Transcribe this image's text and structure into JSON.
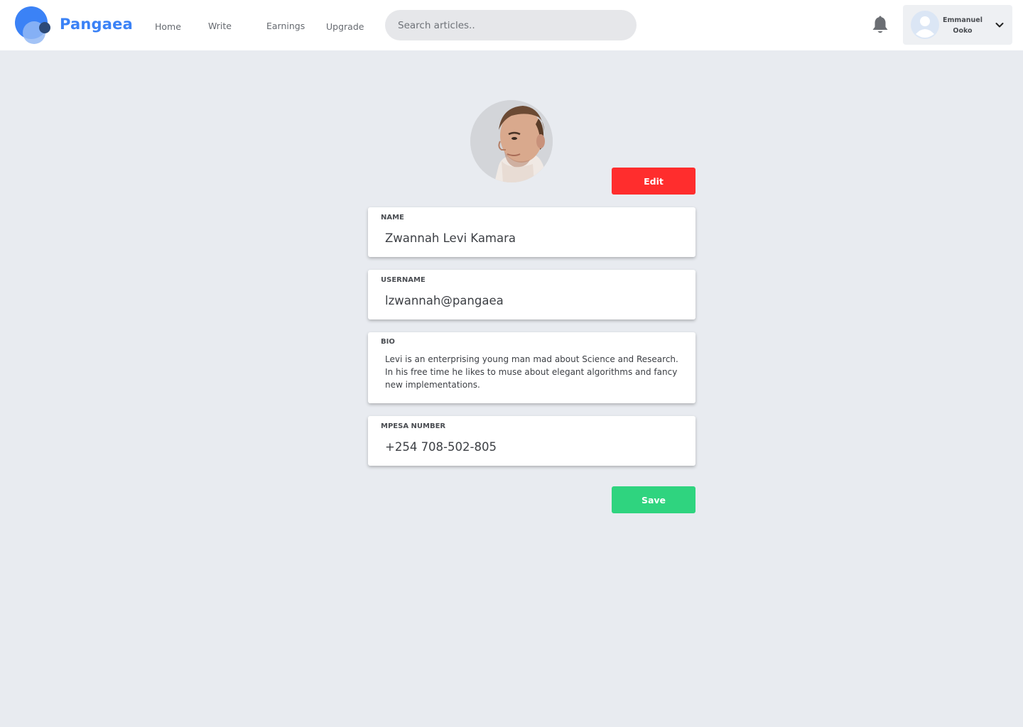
{
  "header": {
    "brand": "Pangaea",
    "nav": [
      "Home",
      "Write",
      "Earnings",
      "Upgrade"
    ],
    "search_placeholder": "Search articles..",
    "user": {
      "first_name": "Emmanuel",
      "last_name": "Ooko"
    }
  },
  "profile": {
    "edit_label": "Edit",
    "save_label": "Save",
    "fields": {
      "name": {
        "label": "NAME",
        "value": "Zwannah Levi Kamara"
      },
      "username": {
        "label": "USERNAME",
        "value": "lzwannah@pangaea"
      },
      "bio": {
        "label": "BIO",
        "value": "Levi is an enterprising young man mad about Science and Research. In his free time he likes to muse about elegant algorithms and fancy new implementations."
      },
      "mpesa": {
        "label": "MPESA NUMBER",
        "value": "+254 708-502-805"
      }
    }
  },
  "colors": {
    "accent": "#3b82f6",
    "edit_button": "#ff2d2d",
    "save_button": "#2fd47f",
    "background": "#e8ebf0"
  },
  "icons": [
    "pangaea-logo-icon",
    "bell-icon",
    "user-avatar-icon",
    "chevron-down-icon"
  ]
}
